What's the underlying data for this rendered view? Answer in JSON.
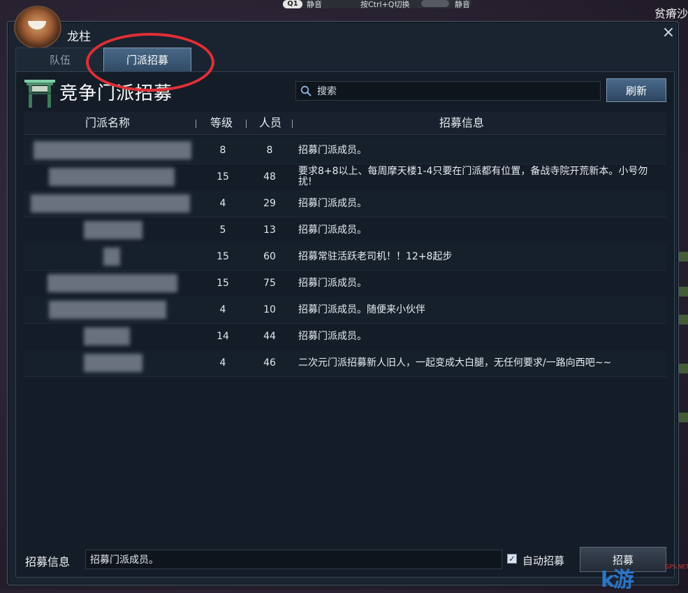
{
  "overlay": {
    "topbar": {
      "hotkey_badge": "Q1",
      "mute_left": "静音",
      "hint": "按Ctrl+Q切换",
      "mute_right": "静音"
    },
    "corner_text": "贫瘠沙"
  },
  "window": {
    "title": "龙柱",
    "close_icon": "×"
  },
  "tabs": [
    {
      "label": "队伍",
      "active": false
    },
    {
      "label": "门派招募",
      "active": true
    }
  ],
  "panel": {
    "title": "竞争门派招募",
    "search_placeholder": "搜索",
    "refresh_label": "刷新"
  },
  "table": {
    "columns": [
      "门派名称",
      "等级",
      "人员",
      "招募信息"
    ],
    "rows": [
      {
        "level": "8",
        "members": "8",
        "info": "招募门派成员。"
      },
      {
        "level": "15",
        "members": "48",
        "info": "要求8+8以上、每周摩天楼1-4只要在门派都有位置，备战寺院开荒新本。小号勿扰!"
      },
      {
        "level": "4",
        "members": "29",
        "info": "招募门派成员。"
      },
      {
        "level": "5",
        "members": "13",
        "info": "招募门派成员。"
      },
      {
        "level": "15",
        "members": "60",
        "info": "招募常驻活跃老司机！！12+8起步"
      },
      {
        "level": "15",
        "members": "75",
        "info": "招募门派成员。"
      },
      {
        "level": "4",
        "members": "10",
        "info": "招募门派成员。随便来小伙伴"
      },
      {
        "level": "14",
        "members": "44",
        "info": "招募门派成员。"
      },
      {
        "level": "4",
        "members": "46",
        "info": "二次元门派招募新人旧人，一起变成大白腿，无任何要求/一路向西吧~~"
      }
    ]
  },
  "footer": {
    "label": "招募信息",
    "input_value": "招募门派成员。",
    "auto_recruit_label": "自动招募",
    "auto_recruit_checked": true,
    "recruit_button": "招募"
  },
  "watermark": {
    "big": "k游",
    "small": "GPS.NET"
  },
  "colors": {
    "window_bg": "#1a2330",
    "panel_bg": "#141c27",
    "active_tab": "#3b5877",
    "annotation_circle": "#e12f35"
  }
}
